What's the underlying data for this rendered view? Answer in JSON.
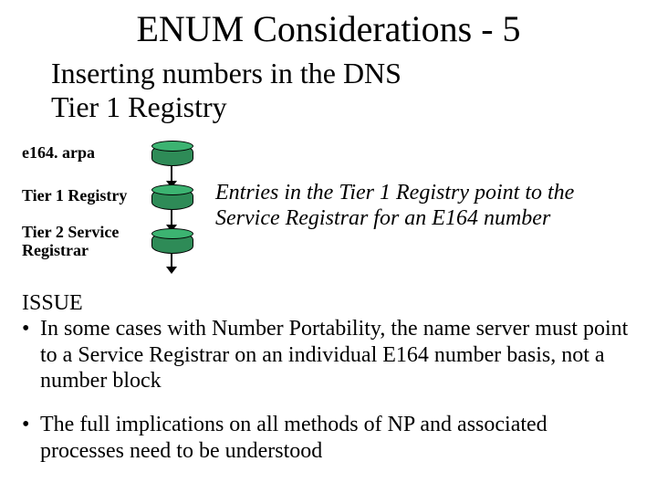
{
  "title": "ENUM Considerations - 5",
  "subtitle_line1": "Inserting numbers in the DNS",
  "subtitle_line2": "Tier 1 Registry",
  "labels": {
    "arpa": "e164. arpa",
    "tier1": "Tier 1 Registry",
    "tier2a": "Tier 2 Service",
    "tier2b": "Registrar"
  },
  "right_para": "Entries in the Tier 1 Registry point to the Service Registrar for an E164 number",
  "issue": {
    "heading": "ISSUE",
    "bullets": [
      "In some cases with Number Portability, the name server must point to a Service Registrar on an individual E164 number basis, not a number block",
      "The full implications on all methods of NP and associated processes need to be understood"
    ]
  },
  "chart_data": {
    "type": "diagram",
    "nodes": [
      {
        "id": "e164-arpa",
        "label": "e164.arpa"
      },
      {
        "id": "tier1-registry",
        "label": "Tier 1 Registry"
      },
      {
        "id": "tier2-service-registrar",
        "label": "Tier 2 Service Registrar"
      }
    ],
    "edges": [
      {
        "from": "e164-arpa",
        "to": "tier1-registry"
      },
      {
        "from": "tier1-registry",
        "to": "tier2-service-registrar"
      },
      {
        "from": "tier2-service-registrar",
        "to": "below"
      }
    ],
    "title": "DNS tier hierarchy"
  }
}
